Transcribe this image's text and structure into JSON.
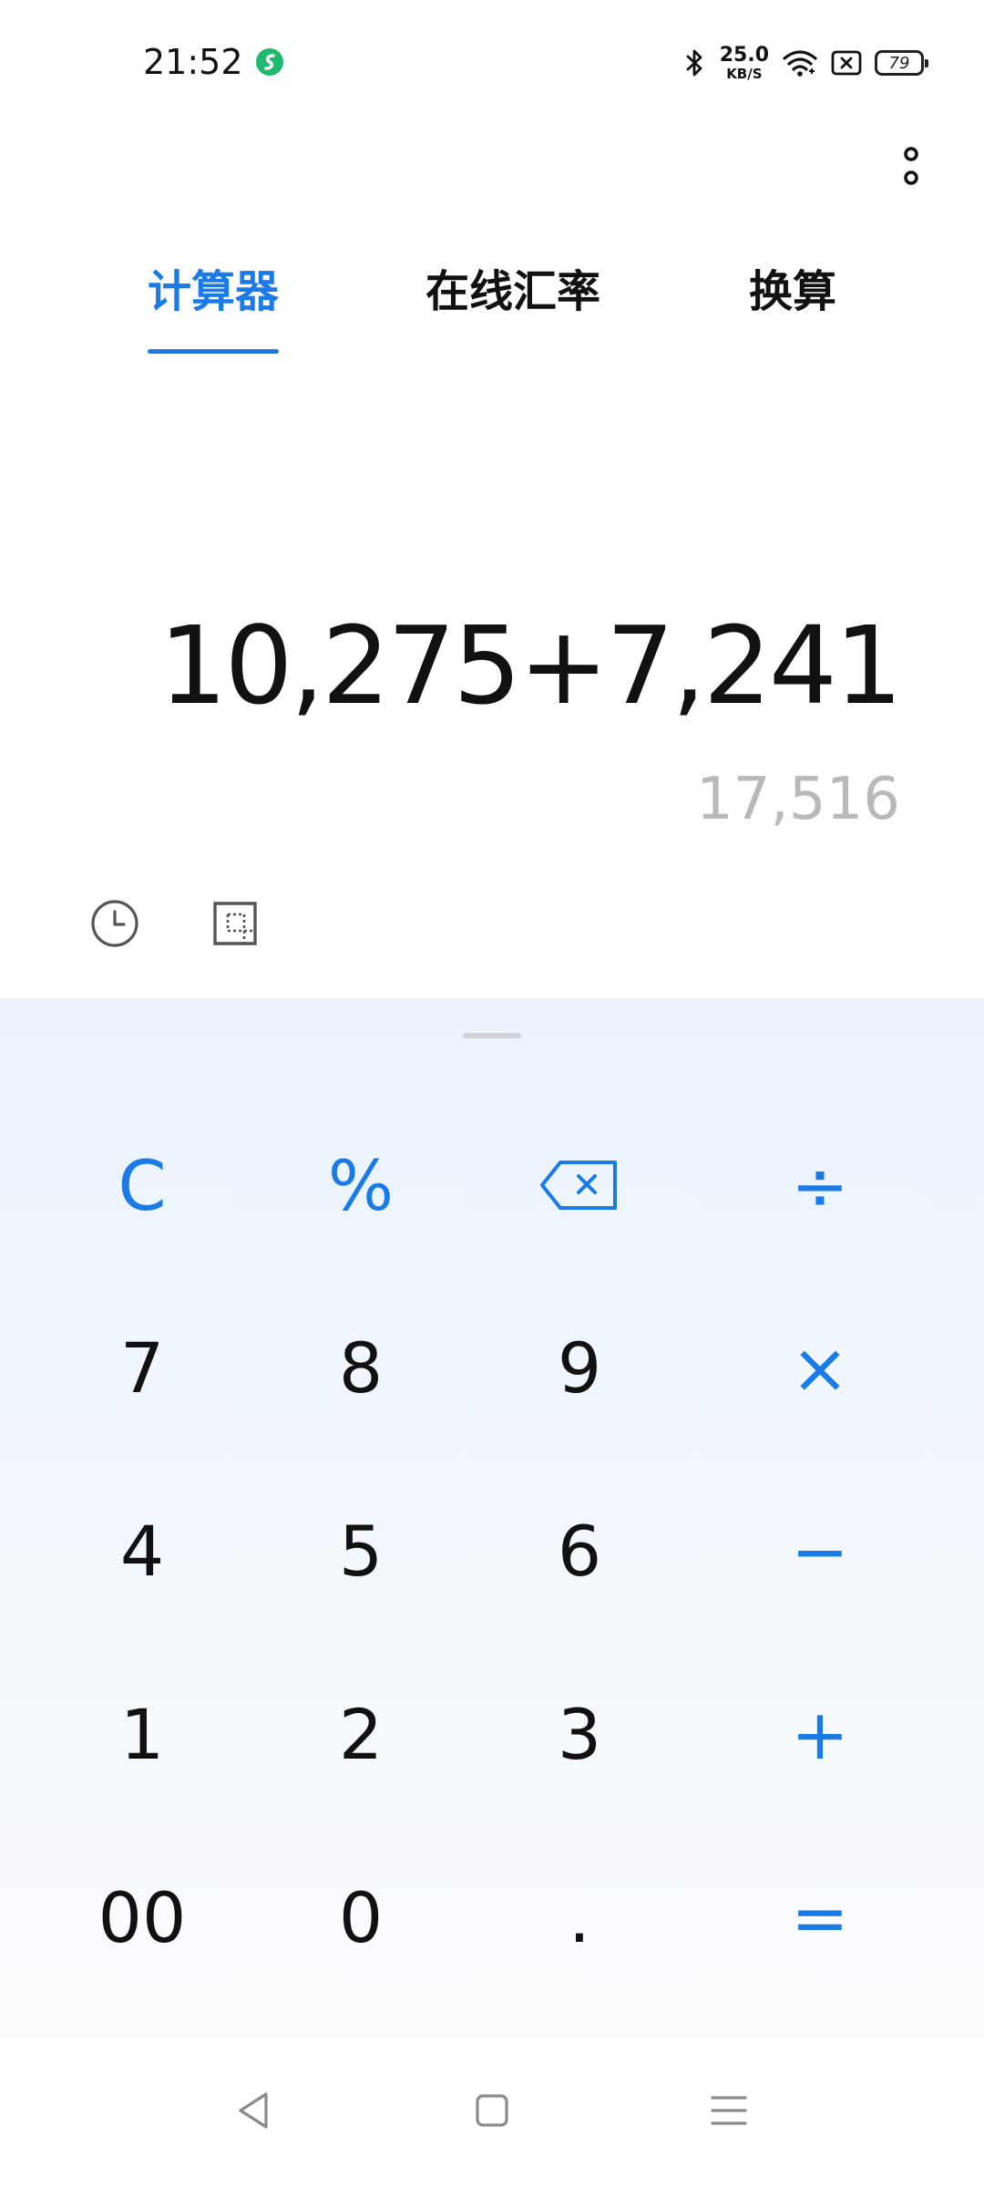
{
  "status_bar": {
    "time": "21:52",
    "speed_value": "25.0",
    "speed_unit": "KB/S",
    "battery_level": "79",
    "app_icon_color": "#1fba6f"
  },
  "tabs": [
    {
      "label": "计算器",
      "active": true
    },
    {
      "label": "在线汇率",
      "active": false
    },
    {
      "label": "换算",
      "active": false
    }
  ],
  "display": {
    "expression": "10,275+7,241",
    "result": "17,516"
  },
  "tools": {
    "history_icon": "clock-icon",
    "scientific_icon": "expand-icon"
  },
  "keypad": {
    "rows": [
      [
        "C",
        "%",
        "backspace",
        "÷"
      ],
      [
        "7",
        "8",
        "9",
        "×"
      ],
      [
        "4",
        "5",
        "6",
        "−"
      ],
      [
        "1",
        "2",
        "3",
        "+"
      ],
      [
        "00",
        "0",
        ".",
        "="
      ]
    ]
  },
  "colors": {
    "accent": "#1a7ae6",
    "result_text": "#b9b9b9",
    "keypad_bg": "#eef5fd"
  },
  "nav_bar": {
    "back_icon": "back-triangle-icon",
    "home_icon": "home-square-icon",
    "menu_icon": "recents-menu-icon"
  }
}
